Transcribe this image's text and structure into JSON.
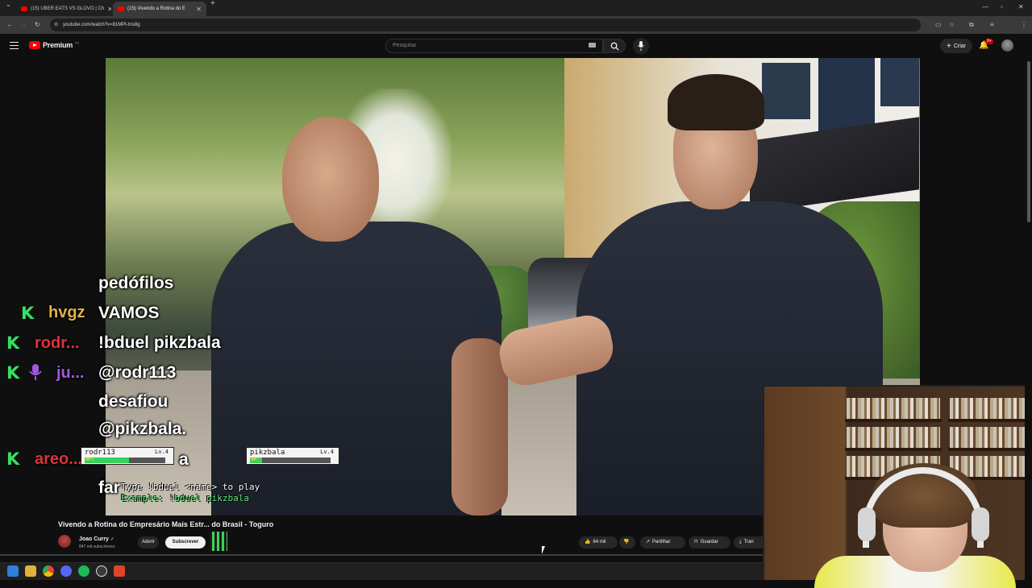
{
  "browser": {
    "tabs": [
      {
        "label": "(15) UBER EATS VS GLOVO | Ch",
        "active": false
      },
      {
        "label": "(15) Vivendo a Rotina do E",
        "active": true
      }
    ],
    "url": "youtube.com/watch?v=81MPt-tns8g"
  },
  "youtube": {
    "logo_text": "Premium",
    "logo_region": "PT",
    "search_placeholder": "Pesquisa",
    "create_label": "Criar",
    "notifications_badge": "9+"
  },
  "chat": {
    "messages": [
      {
        "user": "",
        "text": "pedófilos",
        "user_color": "#ffffff"
      },
      {
        "user": "hvgz",
        "text": "VAMOS",
        "user_color": "#e0b24a"
      },
      {
        "user": "rodr...",
        "text": "!bduel pikzbala",
        "user_color": "#e0323a"
      },
      {
        "user": "ju...",
        "text": "@rodr113",
        "user_color": "#a058e0"
      },
      {
        "user": "",
        "text": "desafiou",
        "user_color": "#ffffff"
      },
      {
        "user": "",
        "text": "@pikzbala.",
        "user_color": "#ffffff"
      },
      {
        "user": "areo...",
        "text": "a",
        "user_color": "#e0323a"
      },
      {
        "user": "",
        "text": "far",
        "user_color": "#ffffff"
      }
    ]
  },
  "duel": {
    "player1": {
      "name": "rodr113",
      "level": "Lv.4",
      "hp_label": "HP:",
      "hp": 0.55
    },
    "player2": {
      "name": "pikzbala",
      "level": "Lv.4",
      "hp_label": "HP:",
      "hp": 0.15
    },
    "instruction": "Type !bduel <name> to play",
    "example": "Example: !bduel pikzbala"
  },
  "video": {
    "title": "Vivendo a Rotina do Empresário Mais Estr... do Brasil - Toguro",
    "channel_name": "Joao Curry",
    "channel_subs": "847 mil subscritores",
    "join_label": "Aderir",
    "subscribe_label": "Subscrever",
    "like_count": "64 mil",
    "share_label": "Partilhar",
    "save_label": "Guardar",
    "download_label": "Tran"
  },
  "colors": {
    "youtube_red": "#ff0000",
    "chat_k_green": "#37e062",
    "background": "#0f0f0f"
  }
}
